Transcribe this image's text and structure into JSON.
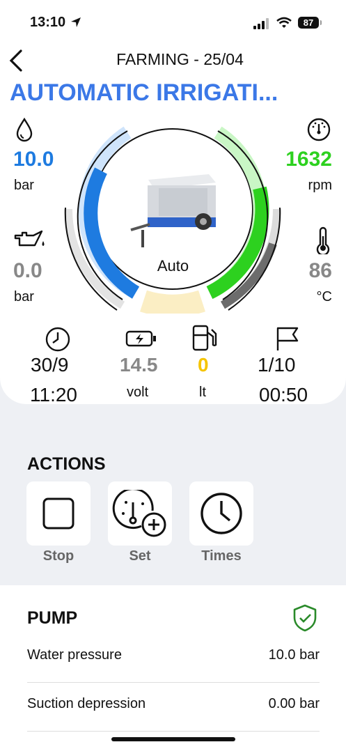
{
  "status": {
    "time": "13:10",
    "battery": "87"
  },
  "nav": {
    "title": "FARMING - 25/04"
  },
  "header": {
    "title": "AUTOMATIC IRRIGATI..."
  },
  "gauge": {
    "mode": "Auto",
    "pressure": {
      "value": "10.0",
      "unit": "bar",
      "level": 0.75
    },
    "rpm": {
      "value": "1632",
      "unit": "rpm",
      "level": 0.7
    },
    "oil": {
      "value": "0.0",
      "unit": "bar",
      "level": 0.0
    },
    "temp": {
      "value": "86",
      "unit": "°C",
      "level": 0.8
    }
  },
  "stats": {
    "date": "30/9",
    "time": "11:20",
    "voltage": "14.5",
    "voltage_unit": "volt",
    "fuel": "0",
    "fuel_unit": "lt",
    "count": "1/10",
    "duration": "00:50"
  },
  "actions": {
    "title": "ACTIONS",
    "items": [
      {
        "label": "Stop"
      },
      {
        "label": "Set"
      },
      {
        "label": "Times"
      }
    ]
  },
  "pump": {
    "title": "PUMP",
    "rows": [
      {
        "label": "Water pressure",
        "value": "10.0 bar"
      },
      {
        "label": "Suction depression",
        "value": "0.00 bar"
      }
    ]
  },
  "colors": {
    "blue": "#1e7be0",
    "green": "#2dd11f",
    "amber": "#f5c400",
    "grey": "#888888"
  }
}
